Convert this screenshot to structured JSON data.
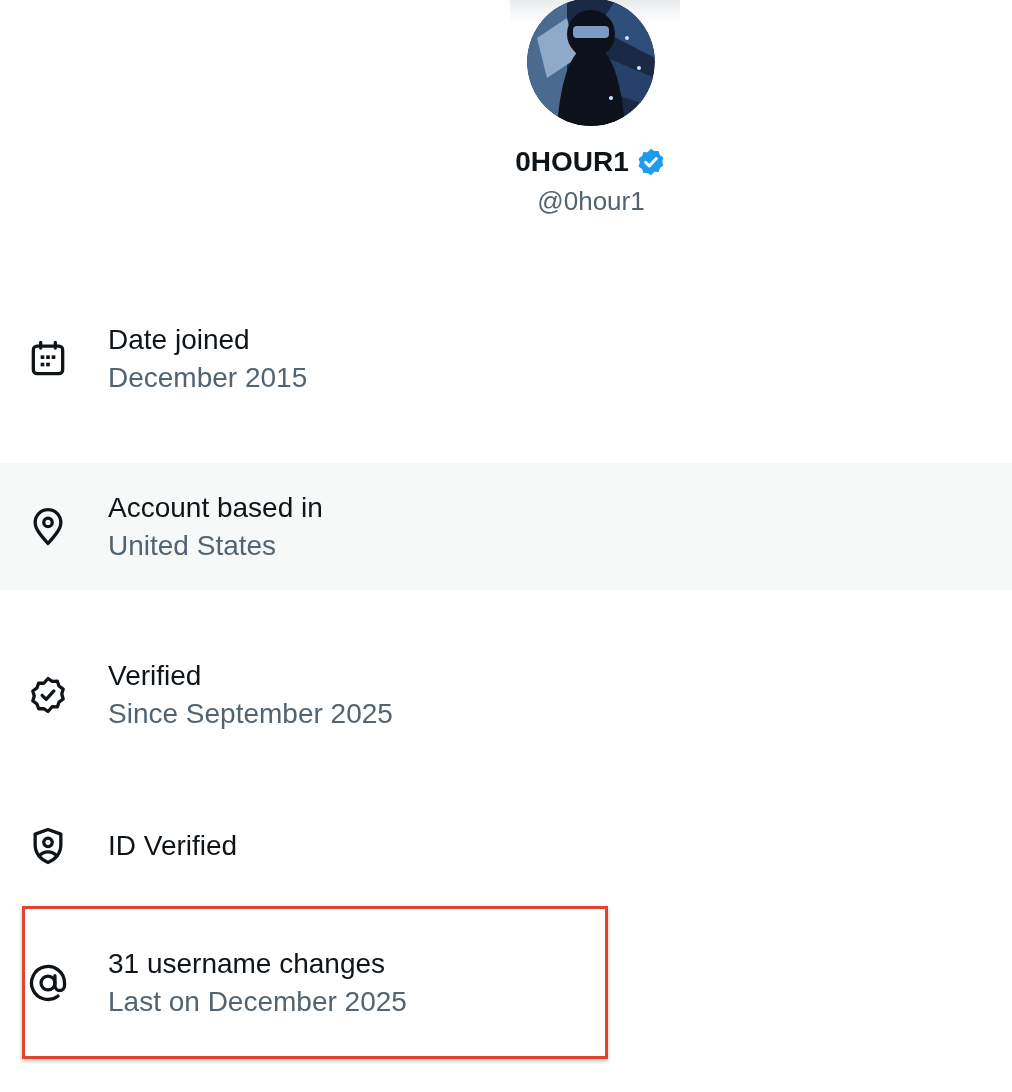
{
  "profile": {
    "name": "0HOUR1",
    "verified": true,
    "handle": "@0hour1"
  },
  "items": [
    {
      "kind": "calendar",
      "title": "Date joined",
      "subtitle": "December 2015",
      "hovered": false,
      "outlined": false
    },
    {
      "kind": "location",
      "title": "Account based in",
      "subtitle": "United States",
      "hovered": true,
      "outlined": false
    },
    {
      "kind": "verified",
      "title": "Verified",
      "subtitle": "Since September 2025",
      "hovered": false,
      "outlined": false
    },
    {
      "kind": "id",
      "title": "ID Verified",
      "hovered": false,
      "outlined": false
    },
    {
      "kind": "username",
      "title": "31 username changes",
      "subtitle": "Last on December 2025",
      "hovered": false,
      "outlined": true
    }
  ]
}
